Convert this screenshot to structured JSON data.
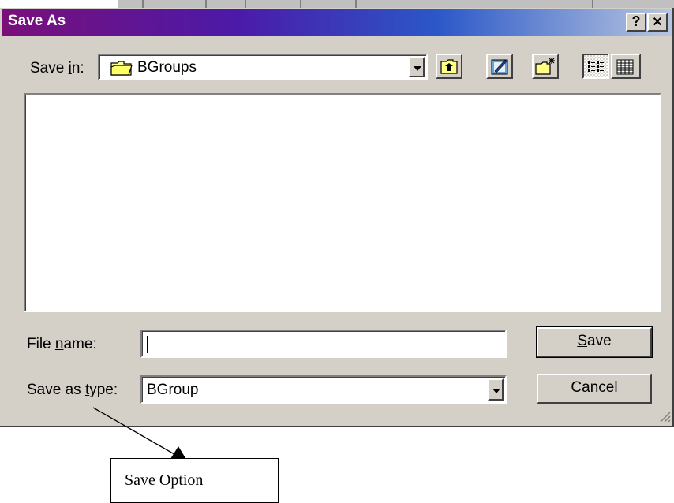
{
  "window": {
    "title": "Save As",
    "help_glyph": "?",
    "close_glyph": "✕"
  },
  "save_in": {
    "label_pre": "Save ",
    "label_u": "i",
    "label_post": "n:",
    "folder_name": "BGroups",
    "folder_icon": "folder-icon"
  },
  "toolbar": {
    "buttons": [
      {
        "name": "up-one-level-button",
        "icon": "up-folder-icon"
      },
      {
        "name": "favorites-button",
        "icon": "favorites-icon"
      },
      {
        "name": "create-new-folder-button",
        "icon": "new-folder-icon"
      },
      {
        "name": "list-view-button",
        "icon": "list-view-icon"
      },
      {
        "name": "details-view-button",
        "icon": "details-view-icon"
      }
    ]
  },
  "file_name": {
    "label_pre": "File ",
    "label_u": "n",
    "label_post": "ame:",
    "value": ""
  },
  "save_as_type": {
    "label_pre": "Save as ",
    "label_u": "t",
    "label_post": "ype:",
    "value": "BGroup"
  },
  "buttons": {
    "save_u": "S",
    "save_rest": "ave",
    "cancel": "Cancel"
  },
  "annotation": {
    "text": "Save Option"
  },
  "colors": {
    "dialog_bg": "#d4d0c8",
    "title_start": "#7a0f7a",
    "title_end": "#b8c6e0"
  }
}
